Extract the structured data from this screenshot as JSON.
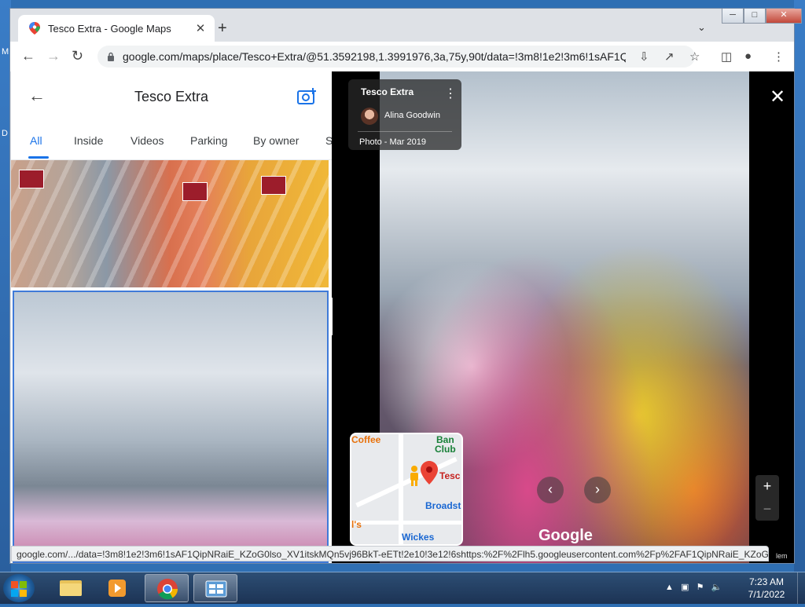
{
  "desktop": {
    "edge_letters": [
      "M",
      "D"
    ]
  },
  "browser": {
    "tab_title": "Tesco Extra - Google Maps",
    "tab_close": "✕",
    "new_tab": "+",
    "url": "google.com/maps/place/Tesco+Extra/@51.3592198,1.3991976,3a,75y,90t/data=!3m8!1e2!3m6!1sAF1Q...",
    "status_url": "google.com/.../data=!3m8!1e2!3m6!1sAF1QipNRaiE_KZoG0lso_XV1itskMQn5vj96BkT-eETt!2e10!3e12!6shttps:%2F%2Flh5.googleusercontent.com%2Fp%2FAF1QipNRaiE_KZoG0lso..."
  },
  "panel": {
    "title": "Tesco Extra",
    "tabs": [
      "All",
      "Inside",
      "Videos",
      "Parking",
      "By owner",
      "S"
    ]
  },
  "viewer": {
    "place": "Tesco Extra",
    "contributor": "Alina Goodwin",
    "date": "Photo - Mar 2019",
    "logo": "Google",
    "help": "lem",
    "zoom_in": "+",
    "zoom_out": "−",
    "minimap": {
      "labels": {
        "coffee": "Coffee",
        "bank": "Ban",
        "club": "Club",
        "tesco": "Tesc",
        "broadst": "Broadst",
        "wickes": "Wickes",
        "ls": "l's"
      }
    }
  },
  "taskbar": {
    "time": "7:23 AM",
    "date": "7/1/2022"
  },
  "colors": {
    "accent": "#1a73e8",
    "pin": "#ea4335",
    "taskbar": "#1c3354"
  }
}
